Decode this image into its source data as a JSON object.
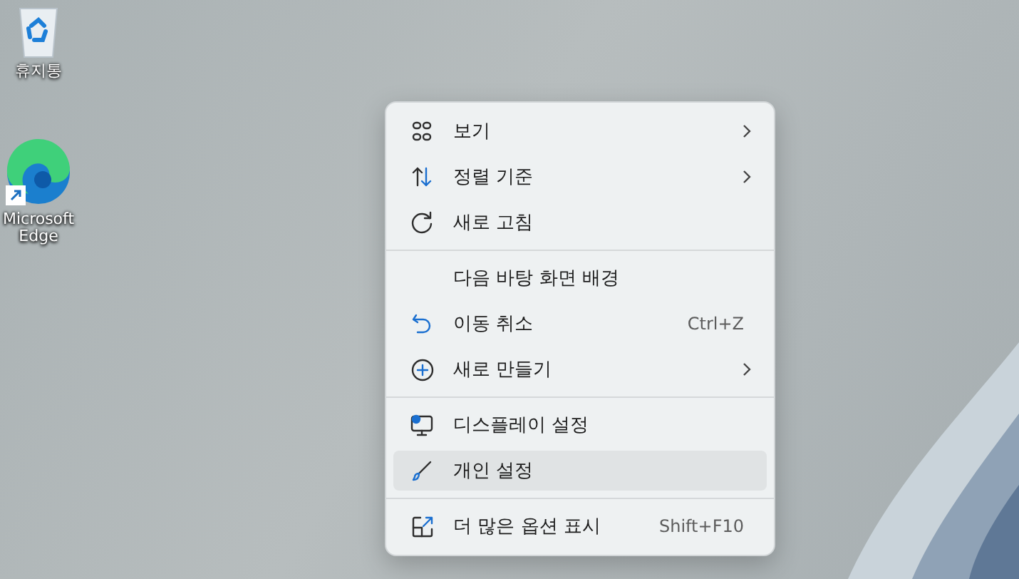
{
  "desktop_icons": [
    {
      "label": "휴지통"
    },
    {
      "label": "Microsoft Edge"
    }
  ],
  "context_menu": {
    "items": [
      {
        "kind": "item",
        "label": "보기",
        "submenu": true,
        "selected": false
      },
      {
        "kind": "item",
        "label": "정렬 기준",
        "submenu": true,
        "selected": false
      },
      {
        "kind": "item",
        "label": "새로 고침",
        "submenu": false,
        "selected": false
      },
      {
        "kind": "separator"
      },
      {
        "kind": "item",
        "label": "다음 바탕 화면 배경",
        "submenu": false,
        "selected": false
      },
      {
        "kind": "item",
        "label": "이동 취소",
        "shortcut": "Ctrl+Z",
        "submenu": false,
        "selected": false
      },
      {
        "kind": "item",
        "label": "새로 만들기",
        "submenu": true,
        "selected": false
      },
      {
        "kind": "separator"
      },
      {
        "kind": "item",
        "label": "디스플레이 설정",
        "submenu": false,
        "selected": false
      },
      {
        "kind": "item",
        "label": "개인 설정",
        "submenu": false,
        "selected": true
      },
      {
        "kind": "separator"
      },
      {
        "kind": "item",
        "label": "더 많은 옵션 표시",
        "shortcut": "Shift+F10",
        "submenu": false,
        "selected": false
      }
    ]
  }
}
